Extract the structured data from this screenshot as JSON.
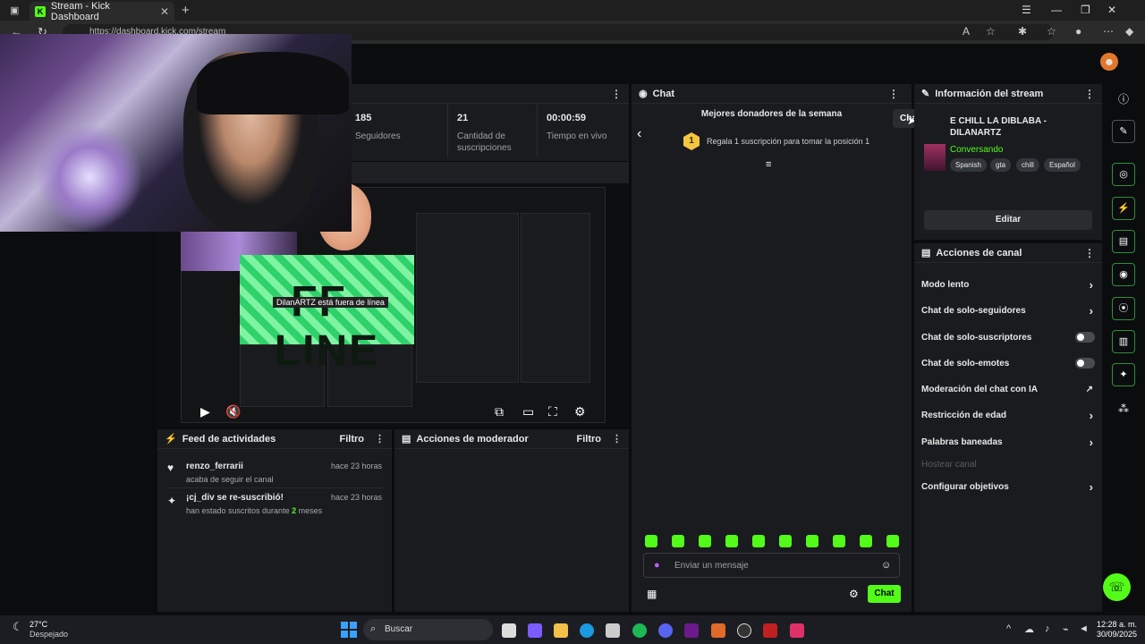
{
  "browser": {
    "tab_title": "Stream - Kick Dashboard",
    "url": "https://dashboard.kick.com/stream"
  },
  "stats": {
    "followers_value": "185",
    "followers_label": "Seguidores",
    "subs_value": "21",
    "subs_label": "Cantidad de suscripciones",
    "live_value": "00:00:59",
    "live_label": "Tiempo en vivo"
  },
  "preview": {
    "offline_text": "FF-LINE",
    "offline_label": "DilanARTZ está fuera de línea"
  },
  "feed": {
    "title": "Feed de actividades",
    "filter_label": "Filtro",
    "items": [
      {
        "user": "renzo_ferrarii",
        "desc": "acaba de seguir el canal",
        "time": "hace 23 horas"
      },
      {
        "user": "¡cj_div se re-suscribió!",
        "desc_prefix": "han estado suscritos durante",
        "desc_count": "2",
        "desc_suffix": "meses",
        "time": "hace 23 horas"
      }
    ]
  },
  "moderator": {
    "title": "Acciones de moderador",
    "filter_label": "Filtro"
  },
  "chat": {
    "title": "Chat",
    "tooltip": "Chat flotante",
    "donors_title": "Mejores donadores de la semana",
    "gift_rank": "1",
    "gift_text": "Regala 1 suscripción para tomar la posición 1",
    "placeholder": "Enviar un mensaje",
    "send_label": "Chat"
  },
  "info": {
    "title": "Información del stream",
    "stream_title": "E CHILL LA DIBLABA - DILANARTZ",
    "category": "Conversando",
    "tags": [
      "Spanish",
      "gta",
      "chill",
      "Español"
    ],
    "edit_label": "Editar"
  },
  "actions": {
    "title": "Acciones de canal",
    "items": [
      {
        "label": "Modo lento",
        "kind": "chevron"
      },
      {
        "label": "Chat de solo-seguidores",
        "kind": "chevron"
      },
      {
        "label": "Chat de solo-suscriptores",
        "kind": "toggle"
      },
      {
        "label": "Chat de solo-emotes",
        "kind": "toggle"
      },
      {
        "label": "Moderación del chat con IA",
        "kind": "external"
      },
      {
        "label": "Restricción de edad",
        "kind": "chevron"
      },
      {
        "label": "Palabras baneadas",
        "kind": "chevron"
      },
      {
        "label": "Hostear canal",
        "kind": "disabled"
      },
      {
        "label": "Configurar objetivos",
        "kind": "chevron"
      }
    ]
  },
  "taskbar": {
    "temp": "27°C",
    "weather": "Despejado",
    "search": "Buscar",
    "time": "12:28 a. m.",
    "date": "30/09/2025"
  },
  "colors": {
    "accent": "#53fc18",
    "panel": "#191b1f",
    "background": "#0b0c0e"
  }
}
